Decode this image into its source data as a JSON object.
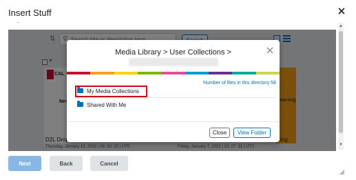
{
  "dialog": {
    "title": "Insert Stuff",
    "close_icon": "close-icon"
  },
  "toolbar": {
    "filter_icon": "filter-icon",
    "search_placeholder": "Search title or description term",
    "search_button": "Search",
    "grid_view_icon": "grid-view-icon",
    "list_view_icon": "list-view-icon"
  },
  "items": [
    {
      "logo_text": "CAL",
      "card_label": "Nev",
      "title": "D2L Drop",
      "date": "Thursday, January 13, 2022 | 08: 33: 20 | UTC"
    },
    {
      "card_label": "earning",
      "title": "ing",
      "date": "Friday, January 7, 2022 | 23: 27: 31 | UTC"
    }
  ],
  "modal": {
    "title": "Media Library > User Collections >",
    "files_count_text": "Number of files in this directory:58",
    "stripe_colors": [
      "#c8102e",
      "#f6a01a",
      "#ffd500",
      "#7ab800",
      "#e84b9a",
      "#009ad6",
      "#6e2e8f",
      "#00a99d",
      "#d1d34a"
    ],
    "folders": [
      {
        "label": "My Media Collections",
        "icon": "folder-icon"
      },
      {
        "label": "Shared With Me",
        "icon": "folder-icon"
      }
    ],
    "close_button": "Close",
    "view_folder_button": "View Folder"
  },
  "footer": {
    "next": "Next",
    "back": "Back",
    "cancel": "Cancel"
  }
}
